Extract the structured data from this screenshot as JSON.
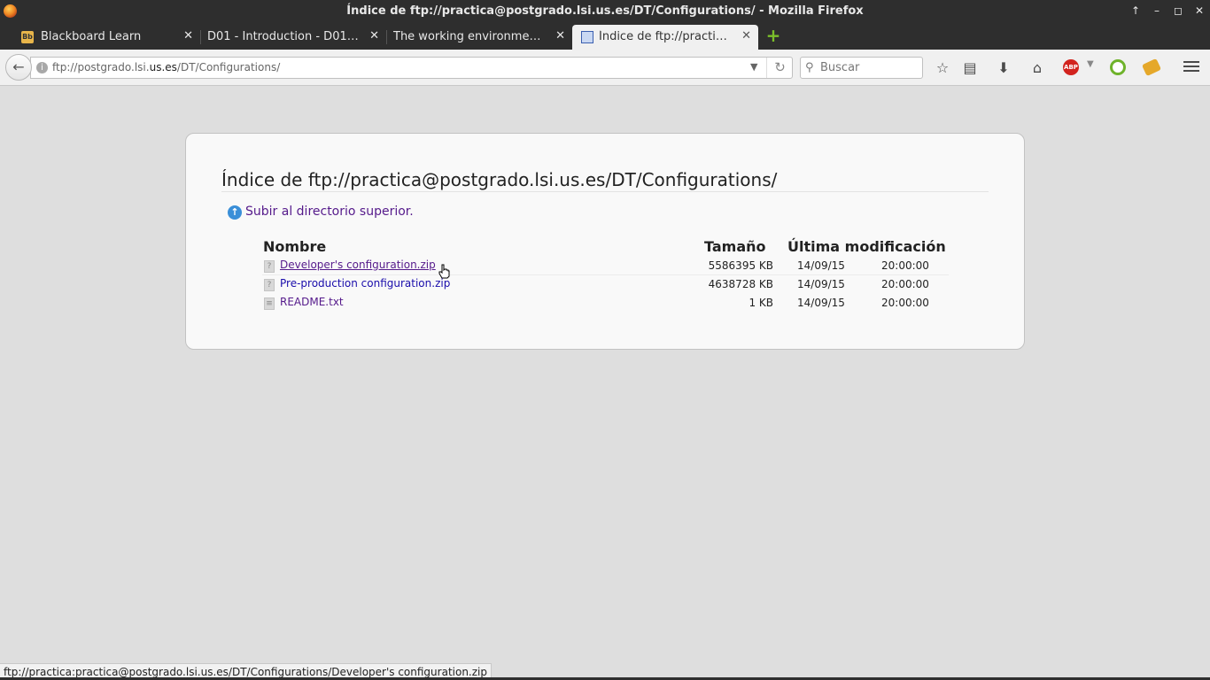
{
  "window": {
    "title": "Índice de ftp://practica@postgrado.lsi.us.es/DT/Configurations/ - Mozilla Firefox"
  },
  "tabs": [
    {
      "label": "Blackboard Learn",
      "favicon": "blackboard-icon",
      "active": false
    },
    {
      "label": "D01 - Introduction - D01 ...",
      "favicon": "none",
      "active": false
    },
    {
      "label": "The working environment...",
      "favicon": "none",
      "active": false
    },
    {
      "label": "Índice de ftp://practic...",
      "favicon": "monitor-icon",
      "active": true
    }
  ],
  "navbar": {
    "url_prefix": "ftp://postgrado.lsi.",
    "url_domain": "us.es",
    "url_suffix": "/DT/Configurations/",
    "search_placeholder": "Buscar"
  },
  "page": {
    "heading": "Índice de ftp://practica@postgrado.lsi.us.es/DT/Configurations/",
    "up_link": "Subir al directorio superior.",
    "columns": {
      "name": "Nombre",
      "size": "Tamaño",
      "modified": "Última modificación"
    },
    "files": [
      {
        "name": "Developer's configuration.zip",
        "size": "5586395 KB",
        "date": "14/09/15",
        "time": "20:00:00",
        "type": "unknown",
        "visited": true
      },
      {
        "name": "Pre-production configuration.zip",
        "size": "4638728 KB",
        "date": "14/09/15",
        "time": "20:00:00",
        "type": "unknown",
        "visited": false
      },
      {
        "name": "README.txt",
        "size": "1 KB",
        "date": "14/09/15",
        "time": "20:00:00",
        "type": "text",
        "visited": true
      }
    ]
  },
  "statusbar": {
    "text": "ftp://practica:practica@postgrado.lsi.us.es/DT/Configurations/Developer's configuration.zip"
  },
  "colors": {
    "chrome_dark": "#2e2e2e",
    "toolbar": "#f0f0f0",
    "page_bg": "#dedede",
    "visited_link": "#551a8b",
    "link": "#1a0dab",
    "new_tab_plus": "#7bbf2a",
    "abp_red": "#d2231e"
  }
}
